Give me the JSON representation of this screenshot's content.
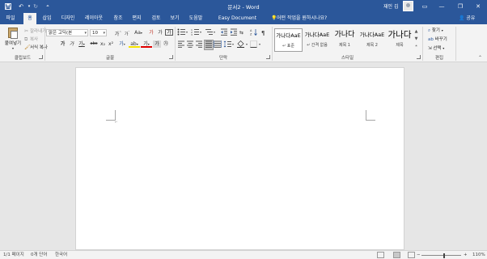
{
  "titlebar": {
    "doc_title": "문서2 - Word",
    "user_name": "재인 김",
    "save_icon": "save-icon",
    "undo_icon": "undo-icon",
    "redo_icon": "redo-icon",
    "customize_icon": "qat-dropdown-icon",
    "ribbon_display_icon": "ribbon-display-icon",
    "minimize": "—",
    "restore": "❐",
    "close": "✕",
    "accent_color": "#2b579a"
  },
  "tabs": [
    {
      "label": "파일"
    },
    {
      "label": "홈"
    },
    {
      "label": "삽입"
    },
    {
      "label": "디자인"
    },
    {
      "label": "레이아웃"
    },
    {
      "label": "참조"
    },
    {
      "label": "편지"
    },
    {
      "label": "검토"
    },
    {
      "label": "보기"
    },
    {
      "label": "도움말"
    },
    {
      "label": "Easy Document Creator"
    }
  ],
  "active_tab": "홈",
  "tell_me": "어떤 작업을 원하시나요?",
  "share": "공유",
  "clipboard": {
    "paste": "붙여넣기",
    "cut": "잘라내기",
    "copy": "복사",
    "format_painter": "서식 복사",
    "group_label": "클립보드"
  },
  "font": {
    "font_name": "맑은 고딕(본",
    "font_size": "10",
    "grow": "가",
    "shrink": "가",
    "change_case": "Aa",
    "clear_format": "가",
    "phonetic": "가",
    "border_char": "가",
    "bold": "가",
    "italic": "가",
    "underline": "가",
    "strike": "abc",
    "subscript": "x₂",
    "superscript": "x²",
    "effects": "가",
    "highlight": "ab",
    "font_color": "가",
    "shading": "가",
    "enclose": "㉮",
    "group_label": "글꼴"
  },
  "paragraph": {
    "group_label": "단락"
  },
  "styles": {
    "items": [
      {
        "sample": "가나다AaE",
        "name": "↵ 표준"
      },
      {
        "sample": "가나다AaE",
        "name": "↵ 간격 없음"
      },
      {
        "sample": "가나다",
        "name": "제목 1"
      },
      {
        "sample": "가나다AaE",
        "name": "제목 2"
      },
      {
        "sample": "가나다",
        "name": "제목"
      }
    ],
    "group_label": "스타일"
  },
  "editing": {
    "find": "찾기",
    "replace": "바꾸기",
    "select": "선택",
    "group_label": "편집"
  },
  "status": {
    "page": "1/1 페이지",
    "words": "0개 단어",
    "language": "한국어",
    "zoom": "110%",
    "zoom_minus": "−",
    "zoom_plus": "+",
    "zoom_level": 0.57
  },
  "document": {
    "paragraph_mark": "↵"
  }
}
